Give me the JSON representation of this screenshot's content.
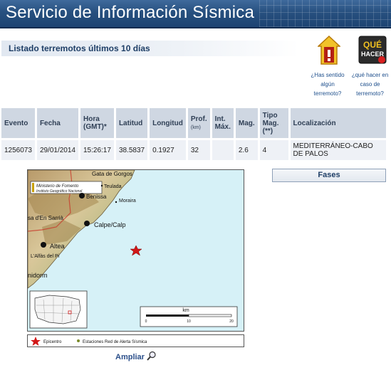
{
  "header": {
    "title": "Servicio de Información Sísmica"
  },
  "subtitle": "Listado terremotos últimos 10 días",
  "links": {
    "felt": [
      "¿Has sentido",
      "algún",
      "terremoto?"
    ],
    "whatdo": [
      "¿qué hacer en",
      "caso de",
      "terremoto?"
    ],
    "que_hacer_icon_text": [
      "QUÉ",
      "HACER"
    ]
  },
  "table": {
    "headers": [
      {
        "main": "Evento",
        "sub": ""
      },
      {
        "main": "Fecha",
        "sub": ""
      },
      {
        "main": "Hora",
        "sub": "(GMT)*"
      },
      {
        "main": "Latitud",
        "sub": ""
      },
      {
        "main": "Longitud",
        "sub": ""
      },
      {
        "main": "Prof.",
        "sub": "(km)"
      },
      {
        "main": "Int.",
        "sub": "Máx."
      },
      {
        "main": "Mag.",
        "sub": ""
      },
      {
        "main": "Tipo",
        "sub": "Mag. (**)"
      },
      {
        "main": "Localización",
        "sub": ""
      }
    ],
    "rows": [
      [
        "1256073",
        "29/01/2014",
        "15:26:17",
        "38.5837",
        "0.1927",
        "32",
        "",
        "2.6",
        "4",
        "MEDITERRÁNEO-CABO DE PALOS"
      ]
    ]
  },
  "map": {
    "institution": [
      "Ministerio de Fomento",
      "Instituto Geográfico Nacional"
    ],
    "places": [
      "Gata de Gorgos",
      "Teulada",
      "Benissa",
      "Moraira",
      "Calpe/Calp",
      "Altea",
      "L'Alfàs del Pi",
      "nidorm",
      "sa d'En Sarrià"
    ],
    "scale_unit": "km",
    "scale_ticks": [
      "0",
      "10",
      "20"
    ]
  },
  "legend": {
    "epicenter": "Epicentro",
    "stations": "Estaciones Red de Alerta Sísmica"
  },
  "buttons": {
    "fases": "Fases",
    "ampliar": "Ampliar"
  },
  "colors": {
    "banner": "#27507f",
    "epicenter": "#cc1111",
    "station": "#7a8a2a"
  }
}
